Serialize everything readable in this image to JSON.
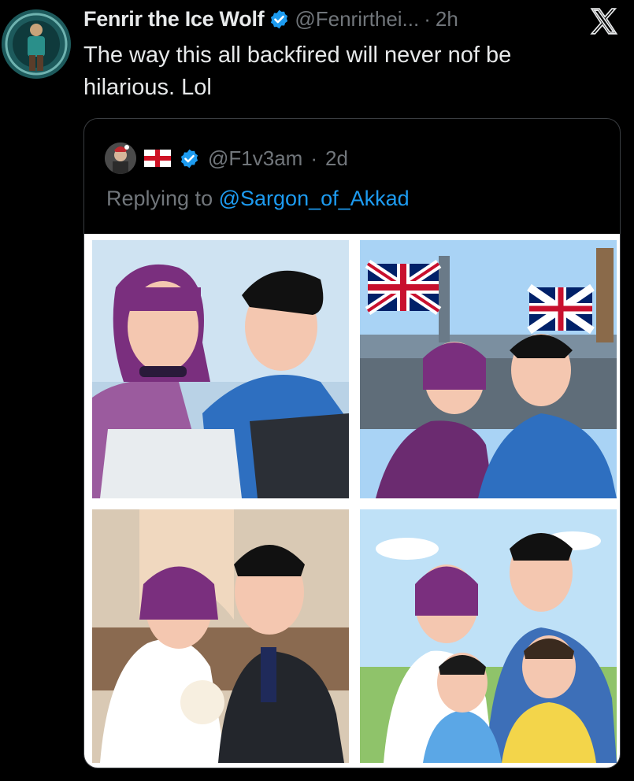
{
  "tweet": {
    "author_name": "Fenrir the Ice Wolf",
    "handle": "@Fenrirthei...",
    "separator": "·",
    "time": "2h",
    "text": "The way this all backfired will never nof be hilarious. Lol"
  },
  "quoted": {
    "handle": "@F1v3am",
    "separator": "·",
    "time": "2d",
    "replying_prefix": "Replying to",
    "replying_to": "@Sargon_of_Akkad"
  },
  "icons": {
    "verified": "verified-badge-icon",
    "close": "x-logo-icon",
    "flag": "england-flag-icon"
  },
  "colors": {
    "background": "#000000",
    "text": "#e7e9ea",
    "muted": "#71767b",
    "accent": "#1d9bf0"
  }
}
